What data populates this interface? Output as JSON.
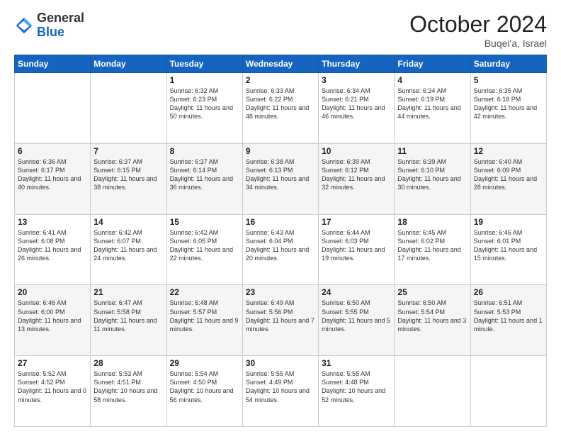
{
  "header": {
    "logo_general": "General",
    "logo_blue": "Blue",
    "month_title": "October 2024",
    "location": "Buqei'a, Israel"
  },
  "columns": [
    "Sunday",
    "Monday",
    "Tuesday",
    "Wednesday",
    "Thursday",
    "Friday",
    "Saturday"
  ],
  "weeks": [
    {
      "row_style": "normal-row",
      "days": [
        {
          "num": "",
          "info": ""
        },
        {
          "num": "",
          "info": ""
        },
        {
          "num": "1",
          "info": "Sunrise: 6:32 AM\nSunset: 6:23 PM\nDaylight: 11 hours and 50 minutes."
        },
        {
          "num": "2",
          "info": "Sunrise: 6:33 AM\nSunset: 6:22 PM\nDaylight: 11 hours and 48 minutes."
        },
        {
          "num": "3",
          "info": "Sunrise: 6:34 AM\nSunset: 6:21 PM\nDaylight: 11 hours and 46 minutes."
        },
        {
          "num": "4",
          "info": "Sunrise: 6:34 AM\nSunset: 6:19 PM\nDaylight: 11 hours and 44 minutes."
        },
        {
          "num": "5",
          "info": "Sunrise: 6:35 AM\nSunset: 6:18 PM\nDaylight: 11 hours and 42 minutes."
        }
      ]
    },
    {
      "row_style": "alt-row",
      "days": [
        {
          "num": "6",
          "info": "Sunrise: 6:36 AM\nSunset: 6:17 PM\nDaylight: 11 hours and 40 minutes."
        },
        {
          "num": "7",
          "info": "Sunrise: 6:37 AM\nSunset: 6:15 PM\nDaylight: 11 hours and 38 minutes."
        },
        {
          "num": "8",
          "info": "Sunrise: 6:37 AM\nSunset: 6:14 PM\nDaylight: 11 hours and 36 minutes."
        },
        {
          "num": "9",
          "info": "Sunrise: 6:38 AM\nSunset: 6:13 PM\nDaylight: 11 hours and 34 minutes."
        },
        {
          "num": "10",
          "info": "Sunrise: 6:39 AM\nSunset: 6:12 PM\nDaylight: 11 hours and 32 minutes."
        },
        {
          "num": "11",
          "info": "Sunrise: 6:39 AM\nSunset: 6:10 PM\nDaylight: 11 hours and 30 minutes."
        },
        {
          "num": "12",
          "info": "Sunrise: 6:40 AM\nSunset: 6:09 PM\nDaylight: 11 hours and 28 minutes."
        }
      ]
    },
    {
      "row_style": "normal-row",
      "days": [
        {
          "num": "13",
          "info": "Sunrise: 6:41 AM\nSunset: 6:08 PM\nDaylight: 11 hours and 26 minutes."
        },
        {
          "num": "14",
          "info": "Sunrise: 6:42 AM\nSunset: 6:07 PM\nDaylight: 11 hours and 24 minutes."
        },
        {
          "num": "15",
          "info": "Sunrise: 6:42 AM\nSunset: 6:05 PM\nDaylight: 11 hours and 22 minutes."
        },
        {
          "num": "16",
          "info": "Sunrise: 6:43 AM\nSunset: 6:04 PM\nDaylight: 11 hours and 20 minutes."
        },
        {
          "num": "17",
          "info": "Sunrise: 6:44 AM\nSunset: 6:03 PM\nDaylight: 11 hours and 19 minutes."
        },
        {
          "num": "18",
          "info": "Sunrise: 6:45 AM\nSunset: 6:02 PM\nDaylight: 11 hours and 17 minutes."
        },
        {
          "num": "19",
          "info": "Sunrise: 6:46 AM\nSunset: 6:01 PM\nDaylight: 11 hours and 15 minutes."
        }
      ]
    },
    {
      "row_style": "alt-row",
      "days": [
        {
          "num": "20",
          "info": "Sunrise: 6:46 AM\nSunset: 6:00 PM\nDaylight: 11 hours and 13 minutes."
        },
        {
          "num": "21",
          "info": "Sunrise: 6:47 AM\nSunset: 5:58 PM\nDaylight: 11 hours and 11 minutes."
        },
        {
          "num": "22",
          "info": "Sunrise: 6:48 AM\nSunset: 5:57 PM\nDaylight: 11 hours and 9 minutes."
        },
        {
          "num": "23",
          "info": "Sunrise: 6:49 AM\nSunset: 5:56 PM\nDaylight: 11 hours and 7 minutes."
        },
        {
          "num": "24",
          "info": "Sunrise: 6:50 AM\nSunset: 5:55 PM\nDaylight: 11 hours and 5 minutes."
        },
        {
          "num": "25",
          "info": "Sunrise: 6:50 AM\nSunset: 5:54 PM\nDaylight: 11 hours and 3 minutes."
        },
        {
          "num": "26",
          "info": "Sunrise: 6:51 AM\nSunset: 5:53 PM\nDaylight: 11 hours and 1 minute."
        }
      ]
    },
    {
      "row_style": "normal-row",
      "days": [
        {
          "num": "27",
          "info": "Sunrise: 5:52 AM\nSunset: 4:52 PM\nDaylight: 11 hours and 0 minutes."
        },
        {
          "num": "28",
          "info": "Sunrise: 5:53 AM\nSunset: 4:51 PM\nDaylight: 10 hours and 58 minutes."
        },
        {
          "num": "29",
          "info": "Sunrise: 5:54 AM\nSunset: 4:50 PM\nDaylight: 10 hours and 56 minutes."
        },
        {
          "num": "30",
          "info": "Sunrise: 5:55 AM\nSunset: 4:49 PM\nDaylight: 10 hours and 54 minutes."
        },
        {
          "num": "31",
          "info": "Sunrise: 5:55 AM\nSunset: 4:48 PM\nDaylight: 10 hours and 52 minutes."
        },
        {
          "num": "",
          "info": ""
        },
        {
          "num": "",
          "info": ""
        }
      ]
    }
  ]
}
